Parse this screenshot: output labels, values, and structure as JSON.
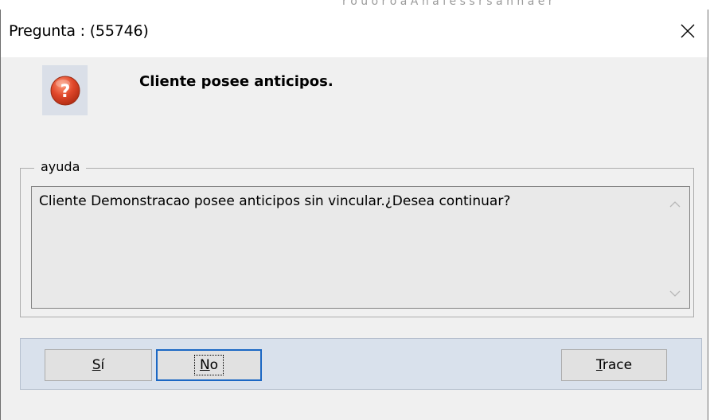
{
  "background": {
    "partial_text": "r o u o  r o a  A n a l e s s r  s  a n  n a e r"
  },
  "dialog": {
    "title": "Pregunta : (55746)",
    "close_glyph": "✕",
    "icon": "question-icon",
    "headline": "Cliente posee anticipos.",
    "group_label": "ayuda",
    "help_text": "Cliente Demonstracao posee anticipos sin vincular.¿Desea continuar?",
    "buttons": {
      "yes_mnemonic": "S",
      "yes_rest": "í",
      "no_mnemonic": "N",
      "no_rest": "o",
      "trace_mnemonic": "T",
      "trace_rest": "race"
    }
  },
  "colors": {
    "dialog_bg": "#f0f0f0",
    "button_panel_bg": "#d9e1ec",
    "focus_border": "#1b67c4",
    "question_icon": "#e0472a"
  }
}
